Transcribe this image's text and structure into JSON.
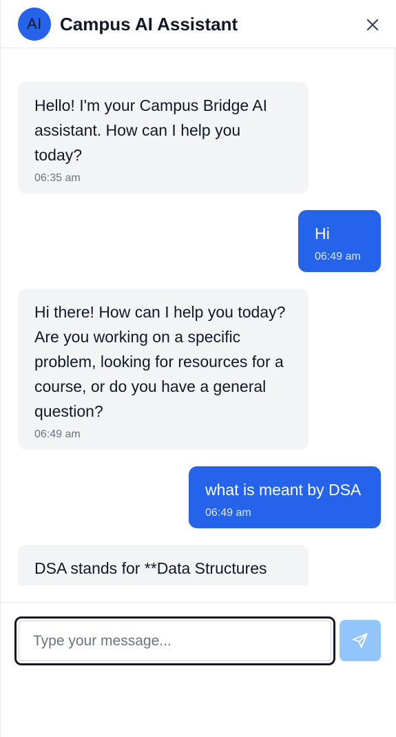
{
  "header": {
    "avatar_text": "AI",
    "title": "Campus AI Assistant",
    "close_icon": "close-icon"
  },
  "messages": [
    {
      "role": "assistant",
      "text": "Hello! I'm your Campus Bridge AI assistant. How can I help you today?",
      "time": "06:35 am"
    },
    {
      "role": "user",
      "text": "Hi",
      "time": "06:49 am"
    },
    {
      "role": "assistant",
      "text": "Hi there! How can I help you today? Are you working on a specific problem, looking for resources for a course, or do you have a general question?",
      "time": "06:49 am"
    },
    {
      "role": "user",
      "text": "what is meant by DSA",
      "time": "06:49 am"
    },
    {
      "role": "assistant",
      "text": "DSA stands for **Data Structures and Algorithms**",
      "time": ""
    }
  ],
  "composer": {
    "placeholder": "Type your message...",
    "value": "",
    "send_icon": "send-icon"
  },
  "colors": {
    "accent": "#2563eb",
    "bot_bubble": "#f3f4f6",
    "send_button_disabled": "#93c5fd"
  }
}
